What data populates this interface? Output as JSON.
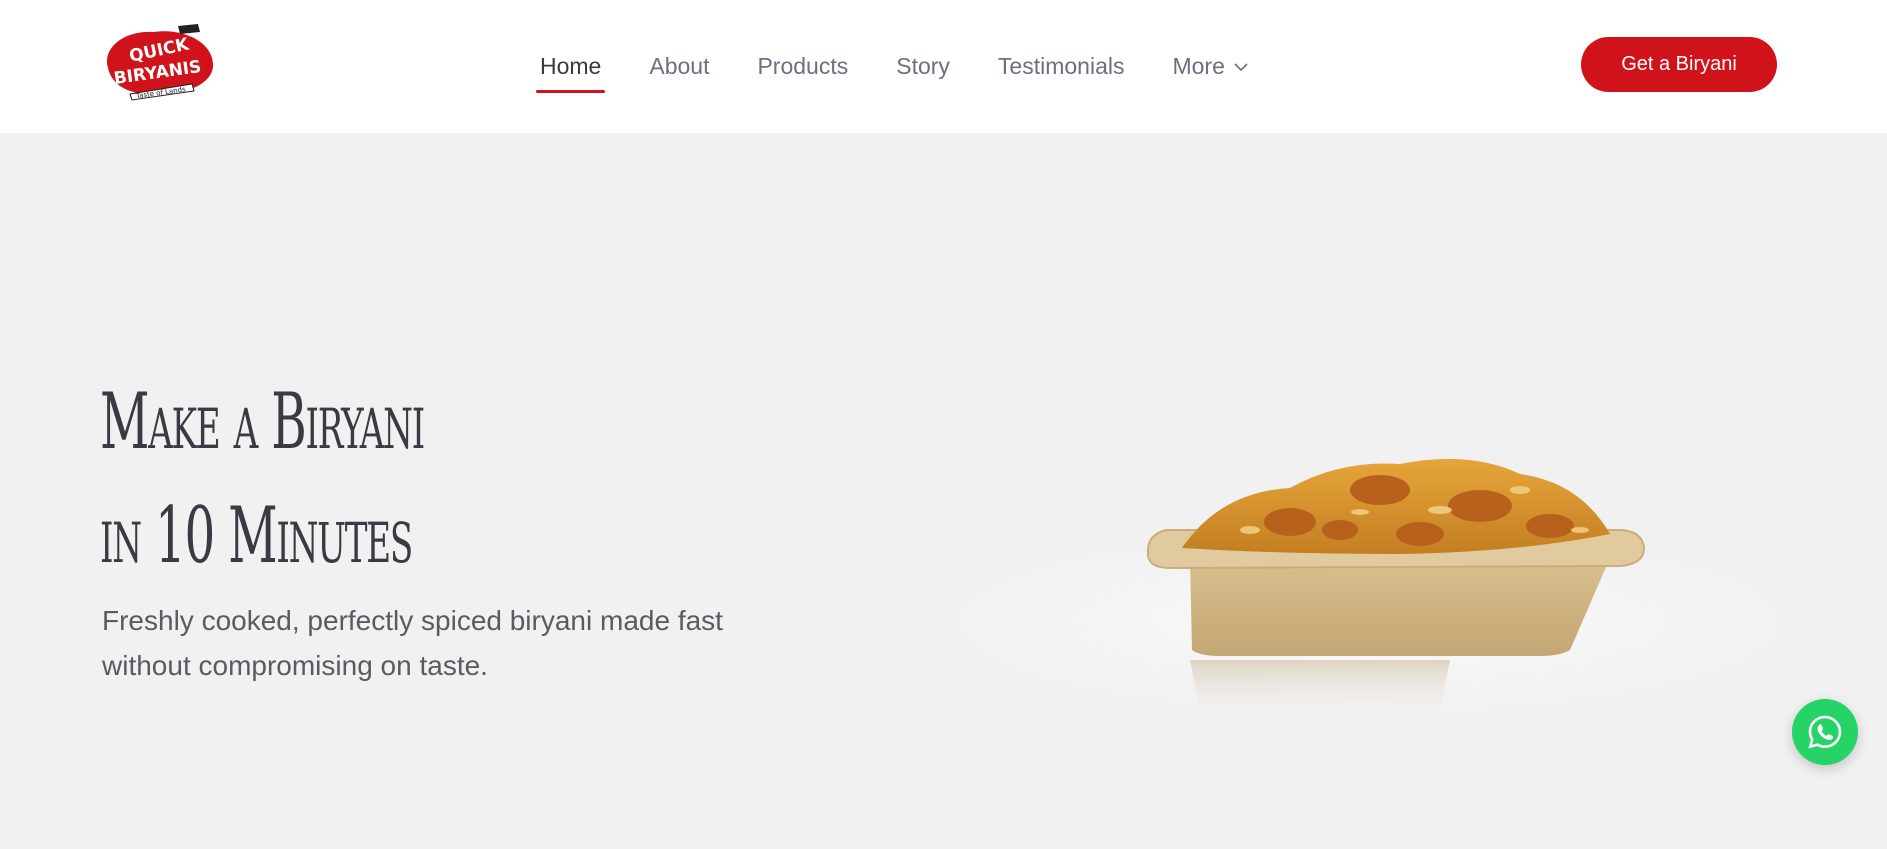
{
  "brand": {
    "logo_top": "QUICK",
    "logo_bottom": "BIRYANIS",
    "tagline": "Taste of Lands",
    "color": "#d0121a"
  },
  "nav": {
    "items": [
      {
        "label": "Home",
        "active": true
      },
      {
        "label": "About"
      },
      {
        "label": "Products"
      },
      {
        "label": "Story"
      },
      {
        "label": "Testimonials"
      },
      {
        "label": "More",
        "icon": "chevron-down-icon"
      }
    ],
    "cta_label": "Get a Biryani"
  },
  "hero": {
    "title_line1": "Make a Biryani",
    "title_line2": "in 10 Minutes",
    "subtitle": "Freshly cooked, perfectly spiced biryani made fast without compromising on taste.",
    "image": "biryani-tray"
  },
  "floating": {
    "whatsapp_icon": "whatsapp-icon",
    "color": "#25d366"
  }
}
